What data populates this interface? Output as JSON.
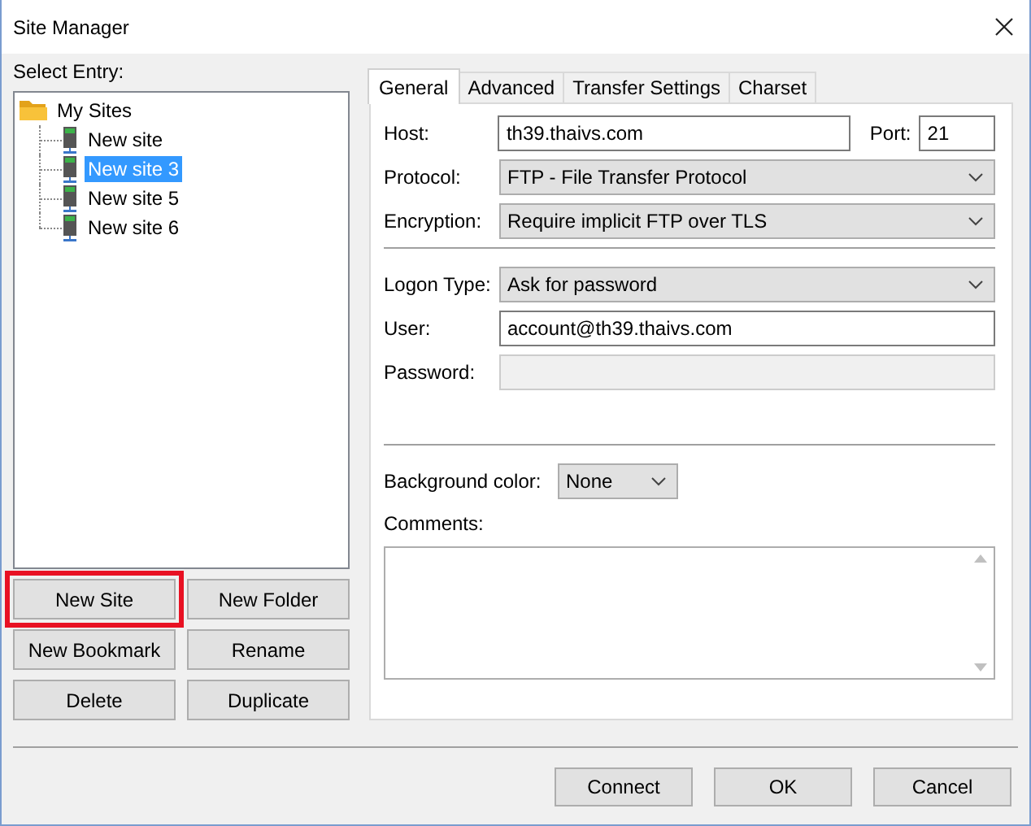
{
  "window": {
    "title": "Site Manager"
  },
  "select_entry_label": "Select Entry:",
  "tree": [
    {
      "label": "My Sites",
      "kind": "folder",
      "selected": false,
      "children": [
        {
          "label": "New site",
          "kind": "site",
          "selected": false
        },
        {
          "label": "New site 3",
          "kind": "site",
          "selected": true
        },
        {
          "label": "New site 5",
          "kind": "site",
          "selected": false
        },
        {
          "label": "New site 6",
          "kind": "site",
          "selected": false
        }
      ]
    }
  ],
  "entry_buttons": [
    {
      "label": "New Site",
      "highlighted": true
    },
    {
      "label": "New Folder",
      "highlighted": false
    },
    {
      "label": "New Bookmark",
      "highlighted": false
    },
    {
      "label": "Rename",
      "highlighted": false
    },
    {
      "label": "Delete",
      "highlighted": false
    },
    {
      "label": "Duplicate",
      "highlighted": false
    }
  ],
  "tabs": [
    {
      "label": "General",
      "selected": true
    },
    {
      "label": "Advanced",
      "selected": false
    },
    {
      "label": "Transfer Settings",
      "selected": false
    },
    {
      "label": "Charset",
      "selected": false
    }
  ],
  "general": {
    "host": {
      "label": "Host:",
      "value": "th39.thaivs.com"
    },
    "port": {
      "label": "Port:",
      "value": "21"
    },
    "protocol": {
      "label": "Protocol:",
      "value": "FTP - File Transfer Protocol"
    },
    "encryption": {
      "label": "Encryption:",
      "value": "Require implicit FTP over TLS"
    },
    "logon_type": {
      "label": "Logon Type:",
      "value": "Ask for password"
    },
    "user": {
      "label": "User:",
      "value": "account@th39.thaivs.com"
    },
    "password": {
      "label": "Password:",
      "disabled": true
    },
    "background_color": {
      "label": "Background color:",
      "value": "None"
    },
    "comments": {
      "label": "Comments:"
    }
  },
  "dialog_buttons": [
    "Connect",
    "OK",
    "Cancel"
  ]
}
